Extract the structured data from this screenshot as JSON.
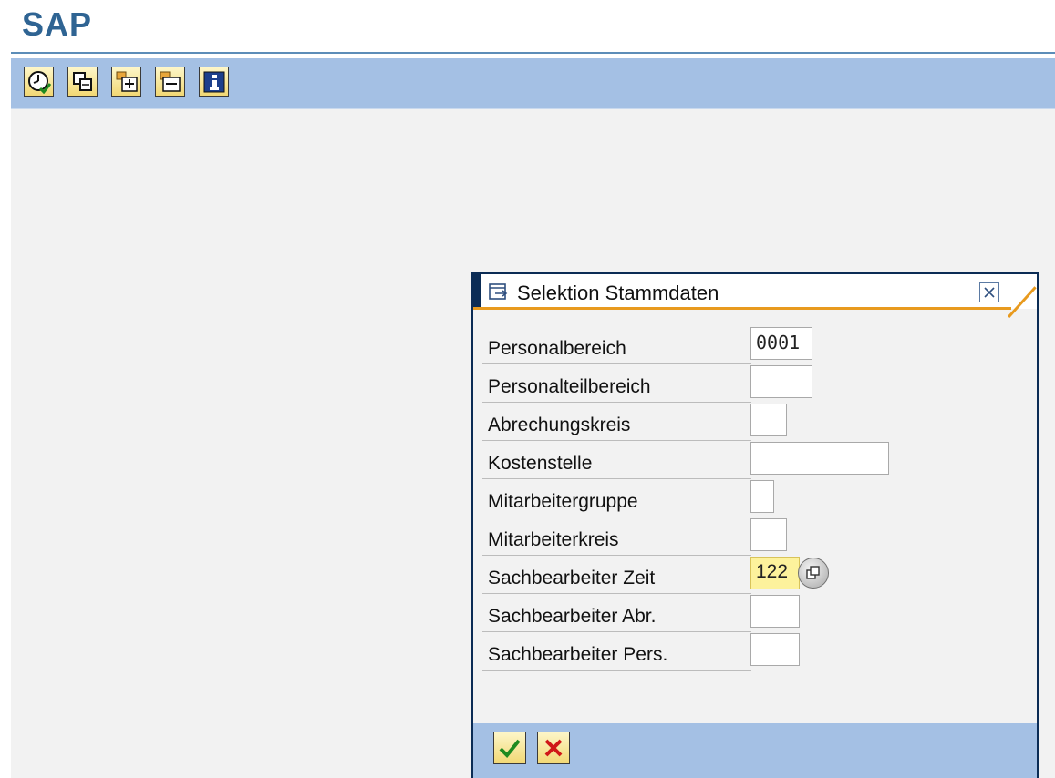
{
  "app": {
    "title": "SAP"
  },
  "toolbar": {
    "buttons": [
      {
        "icon": "clock-execute-icon"
      },
      {
        "icon": "copy-pages-icon"
      },
      {
        "icon": "expand-tree-icon"
      },
      {
        "icon": "collapse-tree-icon"
      },
      {
        "icon": "info-icon"
      }
    ]
  },
  "dialog": {
    "title": "Selektion Stammdaten",
    "fields": [
      {
        "label": "Personalbereich",
        "value": "0001"
      },
      {
        "label": "Personalteilbereich",
        "value": ""
      },
      {
        "label": "Abrechungskreis",
        "value": ""
      },
      {
        "label": "Kostenstelle",
        "value": ""
      },
      {
        "label": "Mitarbeitergruppe",
        "value": ""
      },
      {
        "label": "Mitarbeiterkreis",
        "value": ""
      },
      {
        "label": "Sachbearbeiter Zeit",
        "value": "122"
      },
      {
        "label": "Sachbearbeiter Abr.",
        "value": ""
      },
      {
        "label": "Sachbearbeiter Pers.",
        "value": ""
      }
    ],
    "footer": {
      "confirm_icon": "checkmark-icon",
      "cancel_icon": "cancel-x-icon"
    }
  },
  "colors": {
    "brand_title": "#2f6493",
    "toolbar_bg": "#a4c0e4",
    "dialog_frame": "#0b2c55",
    "dialog_accent": "#e89a1e",
    "highlight_field": "#fdf29c"
  }
}
